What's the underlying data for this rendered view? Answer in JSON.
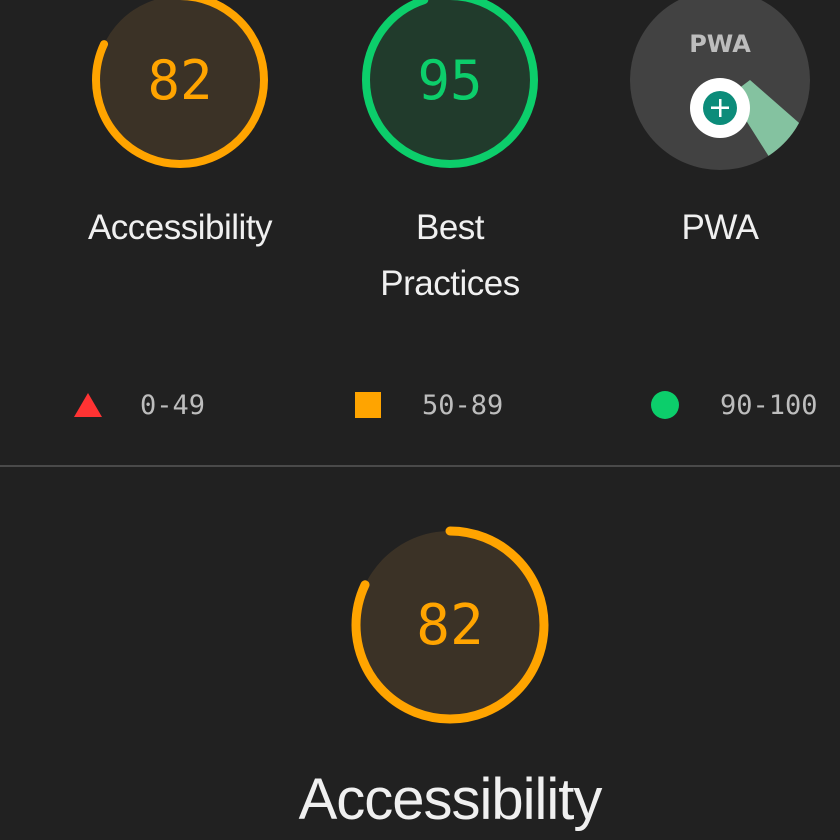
{
  "categories": [
    {
      "id": "accessibility",
      "score": "82",
      "label": "Accessibility",
      "rating": "average",
      "fraction": 0.82
    },
    {
      "id": "best-practices",
      "score": "95",
      "label": "Best\nPractices",
      "rating": "pass",
      "fraction": 0.95
    },
    {
      "id": "pwa",
      "badge_text": "PWA",
      "label": "PWA",
      "icon": "pwa-badge-icon"
    }
  ],
  "legend": [
    {
      "range": "0-49",
      "shape": "triangle",
      "color": "#ff3333"
    },
    {
      "range": "50-89",
      "shape": "square",
      "color": "#ffa400"
    },
    {
      "range": "90-100",
      "shape": "circle",
      "color": "#0cce6b"
    }
  ],
  "selected_category": {
    "score": "82",
    "label": "Accessibility",
    "fraction": 0.82
  },
  "colors": {
    "background": "#212121",
    "average": "#ffa400",
    "average_fill": "#3b3226",
    "pass": "#0cce6b",
    "pass_fill": "#213b2c",
    "pwa_bg": "#424242",
    "pwa_plus": "#0c8c7a",
    "pwa_beam": "#8fd8b0"
  }
}
